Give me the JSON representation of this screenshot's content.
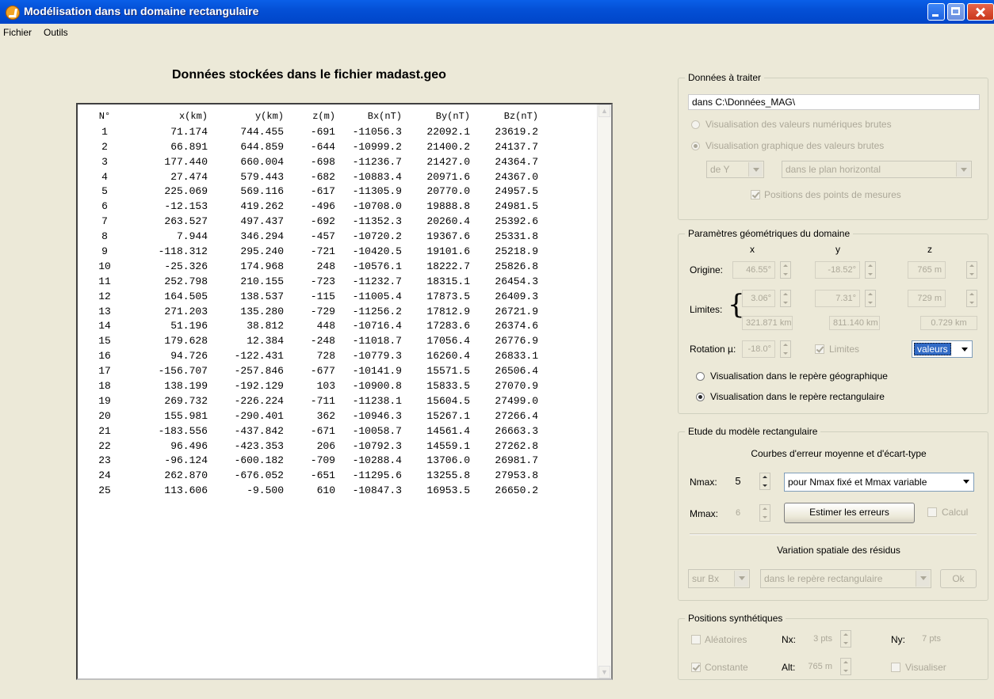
{
  "window": {
    "title": "Modélisation dans un domaine rectangulaire"
  },
  "menu": [
    "Fichier",
    "Outils"
  ],
  "heading": "Données stockées dans le fichier madast.geo",
  "table": {
    "headers": [
      "N°",
      "x(km)",
      "y(km)",
      "z(m)",
      "Bx(nT)",
      "By(nT)",
      "Bz(nT)"
    ],
    "rows": [
      [
        "1",
        "71.174",
        "744.455",
        "-691",
        "-11056.3",
        "22092.1",
        "23619.2"
      ],
      [
        "2",
        "66.891",
        "644.859",
        "-644",
        "-10999.2",
        "21400.2",
        "24137.7"
      ],
      [
        "3",
        "177.440",
        "660.004",
        "-698",
        "-11236.7",
        "21427.0",
        "24364.7"
      ],
      [
        "4",
        "27.474",
        "579.443",
        "-682",
        "-10883.4",
        "20971.6",
        "24367.0"
      ],
      [
        "5",
        "225.069",
        "569.116",
        "-617",
        "-11305.9",
        "20770.0",
        "24957.5"
      ],
      [
        "6",
        "-12.153",
        "419.262",
        "-496",
        "-10708.0",
        "19888.8",
        "24981.5"
      ],
      [
        "7",
        "263.527",
        "497.437",
        "-692",
        "-11352.3",
        "20260.4",
        "25392.6"
      ],
      [
        "8",
        "7.944",
        "346.294",
        "-457",
        "-10720.2",
        "19367.6",
        "25331.8"
      ],
      [
        "9",
        "-118.312",
        "295.240",
        "-721",
        "-10420.5",
        "19101.6",
        "25218.9"
      ],
      [
        "10",
        "-25.326",
        "174.968",
        "248",
        "-10576.1",
        "18222.7",
        "25826.8"
      ],
      [
        "11",
        "252.798",
        "210.155",
        "-723",
        "-11232.7",
        "18315.1",
        "26454.3"
      ],
      [
        "12",
        "164.505",
        "138.537",
        "-115",
        "-11005.4",
        "17873.5",
        "26409.3"
      ],
      [
        "13",
        "271.203",
        "135.280",
        "-729",
        "-11256.2",
        "17812.9",
        "26721.9"
      ],
      [
        "14",
        "51.196",
        "38.812",
        "448",
        "-10716.4",
        "17283.6",
        "26374.6"
      ],
      [
        "15",
        "179.628",
        "12.384",
        "-248",
        "-11018.7",
        "17056.4",
        "26776.9"
      ],
      [
        "16",
        "94.726",
        "-122.431",
        "728",
        "-10779.3",
        "16260.4",
        "26833.1"
      ],
      [
        "17",
        "-156.707",
        "-257.846",
        "-677",
        "-10141.9",
        "15571.5",
        "26506.4"
      ],
      [
        "18",
        "138.199",
        "-192.129",
        "103",
        "-10900.8",
        "15833.5",
        "27070.9"
      ],
      [
        "19",
        "269.732",
        "-226.224",
        "-711",
        "-11238.1",
        "15604.5",
        "27499.0"
      ],
      [
        "20",
        "155.981",
        "-290.401",
        "362",
        "-10946.3",
        "15267.1",
        "27266.4"
      ],
      [
        "21",
        "-183.556",
        "-437.842",
        "-671",
        "-10058.7",
        "14561.4",
        "26663.3"
      ],
      [
        "22",
        "96.496",
        "-423.353",
        "206",
        "-10792.3",
        "14559.1",
        "27262.8"
      ],
      [
        "23",
        "-96.124",
        "-600.182",
        "-709",
        "-10288.4",
        "13706.0",
        "26981.7"
      ],
      [
        "24",
        "262.870",
        "-676.052",
        "-651",
        "-11295.6",
        "13255.8",
        "27953.8"
      ],
      [
        "25",
        "113.606",
        "-9.500",
        "610",
        "-10847.3",
        "16953.5",
        "26650.2"
      ]
    ]
  },
  "donnees": {
    "title": "Données à traiter",
    "path": "dans C:\\Données_MAG\\",
    "radio1": "Visualisation des valeurs numériques brutes",
    "radio2": "Visualisation graphique des valeurs brutes",
    "dd1": "de Y",
    "dd2": "dans le plan horizontal",
    "check": "Positions des points de mesures"
  },
  "params": {
    "title": "Paramètres géométriques du domaine",
    "col_x": "x",
    "col_y": "y",
    "col_z": "z",
    "origine_label": "Origine:",
    "origine": [
      "46.55°",
      "-18.52°",
      "765 m"
    ],
    "limites_label": "Limites:",
    "limites": [
      "3.06°",
      "7.31°",
      "729 m"
    ],
    "limites_km": [
      "321.871 km",
      "811.140 km",
      "0.729 km"
    ],
    "rotation_label": "Rotation µ:",
    "rotation": "-18.0°",
    "limites_check": "Limites",
    "valeurs": "valeurs",
    "radio_geo": "Visualisation dans le repère géographique",
    "radio_rect": "Visualisation dans le repère rectangulaire"
  },
  "etude": {
    "title": "Etude du modèle rectangulaire",
    "subtitle": "Courbes d'erreur moyenne et d'écart-type",
    "nmax_label": "Nmax:",
    "nmax": "5",
    "nmax_dd": "pour Nmax fixé et Mmax variable",
    "mmax_label": "Mmax:",
    "mmax": "6",
    "estimer": "Estimer les erreurs",
    "calcul": "Calcul",
    "variation": "Variation spatiale des résidus",
    "sur": "sur Bx",
    "repere": "dans le repère rectangulaire",
    "ok": "Ok"
  },
  "positions": {
    "title": "Positions synthétiques",
    "aleatoires": "Aléatoires",
    "nx_label": "Nx:",
    "nx": "3 pts",
    "ny_label": "Ny:",
    "ny": "7 pts",
    "constante": "Constante",
    "alt_label": "Alt:",
    "alt": "765 m",
    "visualiser": "Visualiser"
  }
}
